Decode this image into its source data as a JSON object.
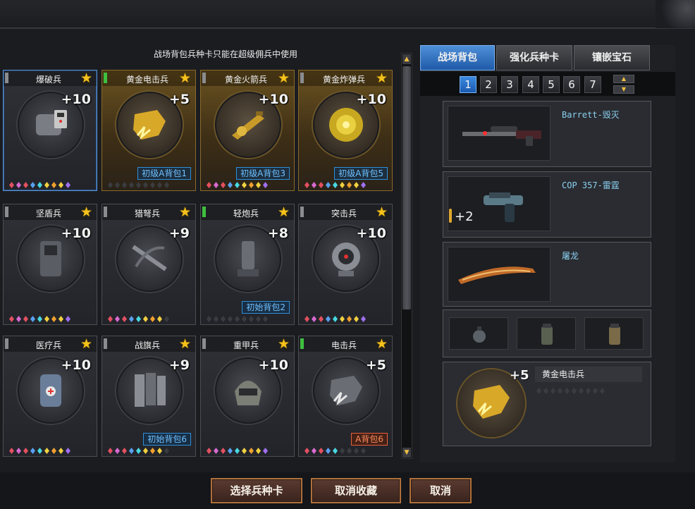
{
  "notice": "战场背包兵种卡只能在超级佣兵中使用",
  "cards": [
    {
      "name": "爆破兵",
      "bonus": "+10",
      "tag": "",
      "tag_style": "",
      "level": "gray",
      "gold": false,
      "selected": true,
      "icon": "c4-bomb-icon",
      "gems": [
        "r",
        "p",
        "r",
        "b",
        "c",
        "y",
        "o",
        "y",
        "v"
      ]
    },
    {
      "name": "黄金电击兵",
      "bonus": "+5",
      "tag": "初级A背包1",
      "tag_style": "blue",
      "level": "green",
      "gold": true,
      "selected": false,
      "icon": "gold-shock-gauntlet-icon",
      "gems": [
        "d",
        "d",
        "d",
        "d",
        "d",
        "d",
        "d",
        "d",
        "d"
      ]
    },
    {
      "name": "黄金火箭兵",
      "bonus": "+10",
      "tag": "初级A背包3",
      "tag_style": "blue",
      "level": "gray",
      "gold": true,
      "selected": false,
      "icon": "gold-rocket-launcher-icon",
      "gems": [
        "r",
        "p",
        "r",
        "b",
        "c",
        "y",
        "o",
        "y",
        "v"
      ]
    },
    {
      "name": "黄金炸弹兵",
      "bonus": "+10",
      "tag": "初级A背包5",
      "tag_style": "blue",
      "level": "gray",
      "gold": true,
      "selected": false,
      "icon": "gold-bomb-sphere-icon",
      "gems": [
        "r",
        "p",
        "r",
        "b",
        "c",
        "y",
        "o",
        "y",
        "v"
      ]
    },
    {
      "name": "坚盾兵",
      "bonus": "+10",
      "tag": "",
      "tag_style": "",
      "level": "gray",
      "gold": false,
      "selected": false,
      "icon": "riot-shield-icon",
      "gems": [
        "r",
        "p",
        "r",
        "b",
        "c",
        "y",
        "o",
        "y",
        "v"
      ]
    },
    {
      "name": "猎弩兵",
      "bonus": "+9",
      "tag": "",
      "tag_style": "",
      "level": "gray",
      "gold": false,
      "selected": false,
      "icon": "crossbow-icon",
      "gems": [
        "r",
        "p",
        "r",
        "b",
        "c",
        "y",
        "o",
        "y",
        "d"
      ]
    },
    {
      "name": "轻炮兵",
      "bonus": "+8",
      "tag": "初始背包2",
      "tag_style": "blue",
      "level": "green",
      "gold": false,
      "selected": false,
      "icon": "mortar-cannon-icon",
      "gems": [
        "d",
        "d",
        "d",
        "d",
        "d",
        "d",
        "d",
        "d",
        "d"
      ]
    },
    {
      "name": "突击兵",
      "bonus": "+10",
      "tag": "",
      "tag_style": "",
      "level": "gray",
      "gold": false,
      "selected": false,
      "icon": "scope-device-icon",
      "gems": [
        "r",
        "p",
        "r",
        "b",
        "c",
        "y",
        "o",
        "y",
        "v"
      ]
    },
    {
      "name": "医疗兵",
      "bonus": "+10",
      "tag": "",
      "tag_style": "",
      "level": "gray",
      "gold": false,
      "selected": false,
      "icon": "medical-canister-icon",
      "gems": [
        "r",
        "p",
        "r",
        "b",
        "c",
        "y",
        "o",
        "y",
        "v"
      ]
    },
    {
      "name": "战旗兵",
      "bonus": "+9",
      "tag": "初始背包6",
      "tag_style": "blue",
      "level": "gray",
      "gold": false,
      "selected": false,
      "icon": "battle-flags-icon",
      "gems": [
        "r",
        "p",
        "r",
        "b",
        "c",
        "y",
        "o",
        "y",
        "d"
      ]
    },
    {
      "name": "重甲兵",
      "bonus": "+10",
      "tag": "",
      "tag_style": "",
      "level": "gray",
      "gold": false,
      "selected": false,
      "icon": "armor-helmet-icon",
      "gems": [
        "r",
        "p",
        "r",
        "b",
        "c",
        "y",
        "o",
        "y",
        "v"
      ]
    },
    {
      "name": "电击兵",
      "bonus": "+5",
      "tag": "A背包6",
      "tag_style": "red",
      "level": "green",
      "gold": false,
      "selected": false,
      "icon": "shock-gauntlet-icon",
      "gems": [
        "r",
        "p",
        "r",
        "b",
        "c",
        "d",
        "d",
        "d",
        "d"
      ]
    }
  ],
  "tabs": [
    "战场背包",
    "强化兵种卡",
    "镶嵌宝石"
  ],
  "active_tab": 0,
  "pages": [
    "1",
    "2",
    "3",
    "4",
    "5",
    "6",
    "7"
  ],
  "active_page": 0,
  "loadout": {
    "primary": {
      "name": "Barrett-毁灭",
      "icon": "sniper-rifle-icon"
    },
    "secondary": {
      "name": "COP 357-雷霆",
      "ammo": "+2",
      "icon": "revolver-pistol-icon"
    },
    "melee": {
      "name": "屠龙",
      "icon": "curved-blade-icon"
    },
    "throwables": [
      "grenade-icon",
      "smoke-grenade-icon",
      "flash-grenade-icon"
    ],
    "card": {
      "name": "黄金电击兵",
      "bonus": "+5",
      "icon": "gold-shock-gauntlet-icon",
      "gems": [
        "d",
        "d",
        "d",
        "d",
        "d",
        "d",
        "d",
        "d",
        "d",
        "d"
      ]
    }
  },
  "buttons": {
    "select": "选择兵种卡",
    "cancel_favorite": "取消收藏",
    "cancel": "取消"
  },
  "colors": {
    "tab_active": "#2f74c8",
    "gold_card": "#6b5220",
    "tag_blue": "#2f8fd8",
    "tag_red": "#e8603a",
    "star": "#f5c21b"
  }
}
